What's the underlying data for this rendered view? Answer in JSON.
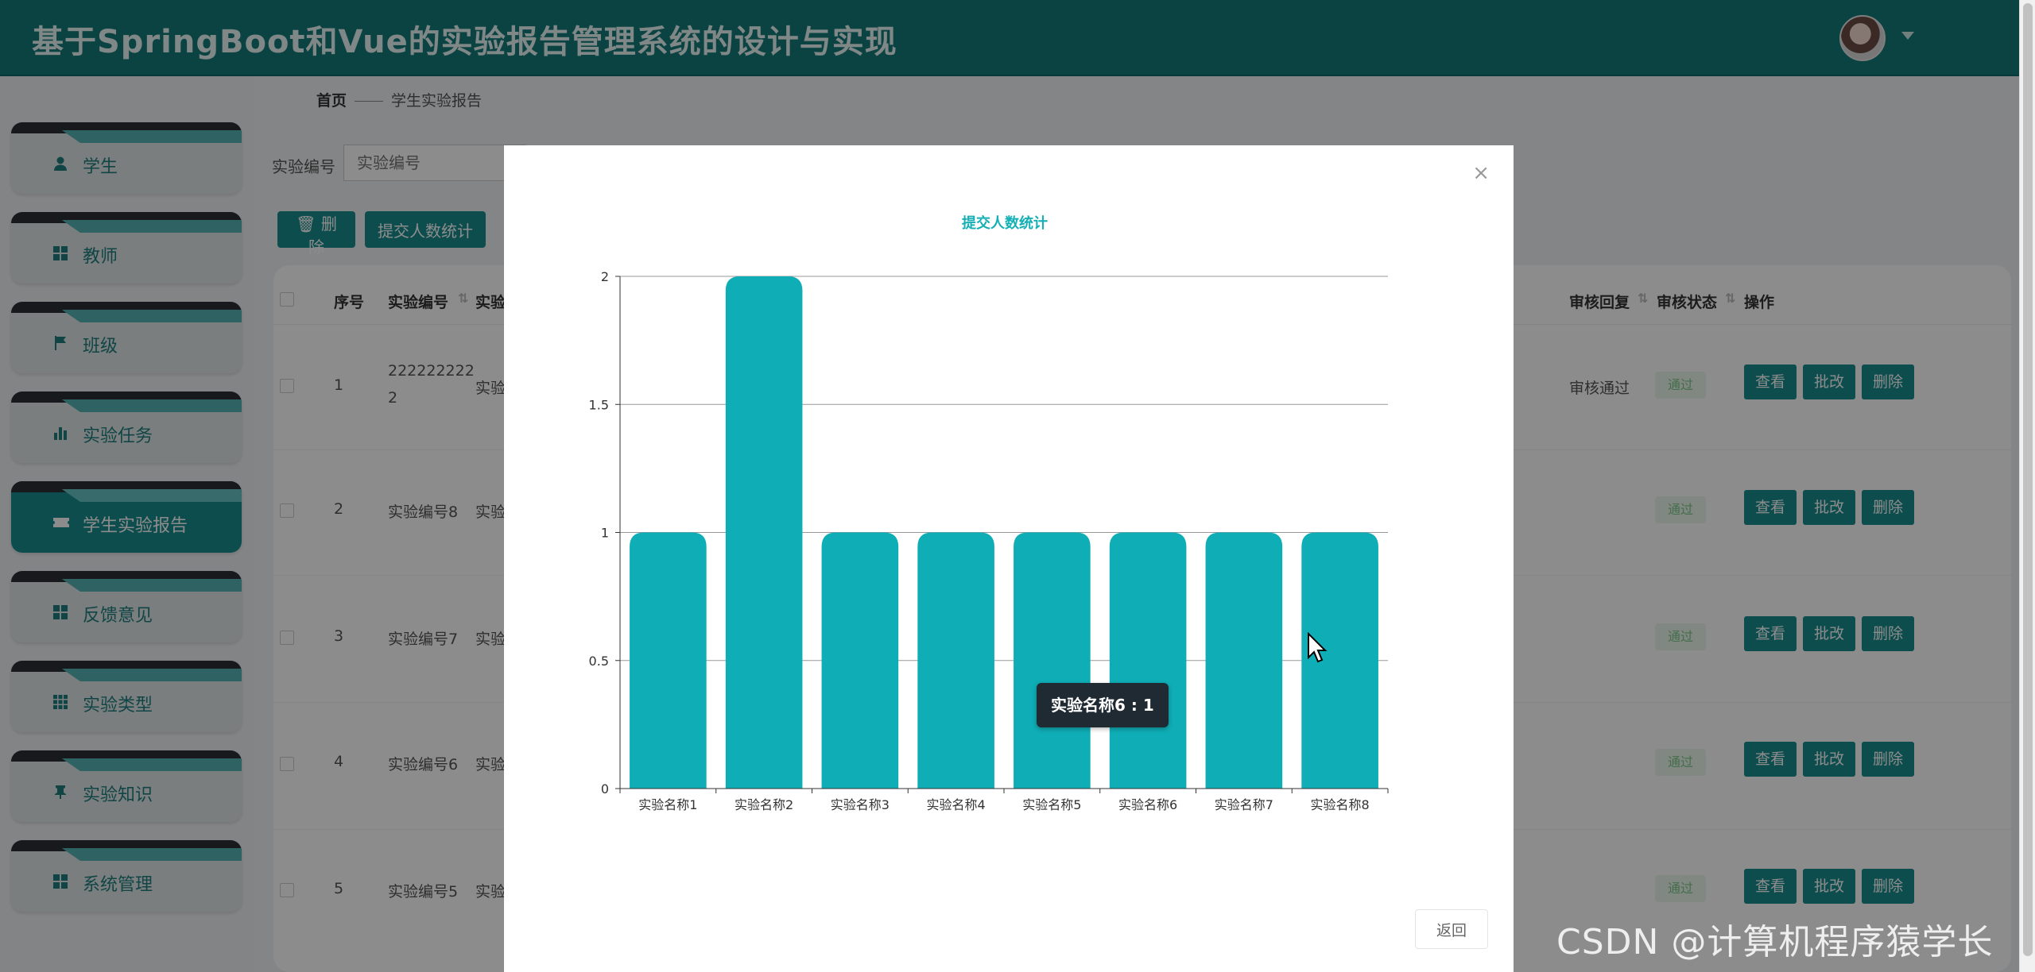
{
  "header": {
    "title": "基于SpringBoot和Vue的实验报告管理系统的设计与实现"
  },
  "sidebar": {
    "items": [
      {
        "label": "学生",
        "icon": "user-icon"
      },
      {
        "label": "教师",
        "icon": "grid-icon"
      },
      {
        "label": "班级",
        "icon": "flag-icon"
      },
      {
        "label": "实验任务",
        "icon": "bar-chart-icon"
      },
      {
        "label": "学生实验报告",
        "icon": "ticket-icon",
        "active": true
      },
      {
        "label": "反馈意见",
        "icon": "grid-icon"
      },
      {
        "label": "实验类型",
        "icon": "apps-icon"
      },
      {
        "label": "实验知识",
        "icon": "pin-icon"
      },
      {
        "label": "系统管理",
        "icon": "grid-icon"
      }
    ]
  },
  "breadcrumb": {
    "home": "首页",
    "current": "学生实验报告"
  },
  "search": {
    "label": "实验编号",
    "placeholder": "实验编号"
  },
  "toolbar": {
    "delete_label": "删除",
    "stats_label": "提交人数统计"
  },
  "table": {
    "headers": {
      "index": "序号",
      "exp_no": "实验编号",
      "exp_name": "实验",
      "review_reply": "审核回复",
      "review_status": "审核状态",
      "actions": "操作"
    },
    "rows": [
      {
        "index": "1",
        "exp_no_line1": "222222222",
        "exp_no_line2": "2",
        "exp_name": "实验",
        "reply": "审核通过",
        "status": "通过"
      },
      {
        "index": "2",
        "exp_no": "实验编号8",
        "exp_name": "实验",
        "reply": "",
        "status": "通过"
      },
      {
        "index": "3",
        "exp_no": "实验编号7",
        "exp_name": "实验",
        "reply": "",
        "status": "通过"
      },
      {
        "index": "4",
        "exp_no": "实验编号6",
        "exp_name": "实验",
        "reply": "",
        "status": "通过"
      },
      {
        "index": "5",
        "exp_no": "实验编号5",
        "exp_name": "实验",
        "reply": "",
        "status": "通过"
      }
    ],
    "action_labels": {
      "view": "查看",
      "grade": "批改",
      "delete": "删除"
    }
  },
  "dialog": {
    "back_label": "返回",
    "close_icon": "close-icon"
  },
  "chart_data": {
    "type": "bar",
    "title": "提交人数统计",
    "categories": [
      "实验名称1",
      "实验名称2",
      "实验名称3",
      "实验名称4",
      "实验名称5",
      "实验名称6",
      "实验名称7",
      "实验名称8"
    ],
    "values": [
      1,
      2,
      1,
      1,
      1,
      1,
      1,
      1
    ],
    "ylim": [
      0,
      2
    ],
    "yticks": [
      "0",
      "0.5",
      "1",
      "1.5",
      "2"
    ],
    "grid": true,
    "bar_color": "#0fadb5",
    "tooltip": "实验名称6 : 1"
  },
  "watermark": "CSDN @计算机程序猿学长",
  "colors": {
    "primary": "#1b8d8d",
    "header": "#147a7a",
    "bar": "#0fadb5"
  }
}
